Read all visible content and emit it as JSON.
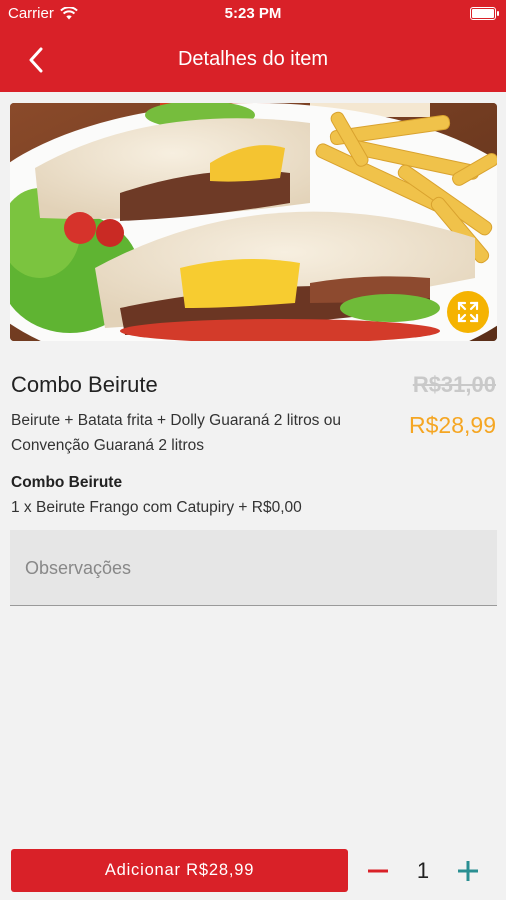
{
  "status_bar": {
    "carrier": "Carrier",
    "time": "5:23 PM"
  },
  "nav": {
    "title": "Detalhes do item"
  },
  "item": {
    "name": "Combo Beirute",
    "old_price": "R$31,00",
    "price": "R$28,99",
    "description": "Beirute + Batata frita + Dolly Guaraná 2 litros ou Convenção Guaraná 2 litros",
    "group_title": "Combo Beirute",
    "group_line": "1 x Beirute Frango com Catupiry + R$0,00"
  },
  "notes": {
    "placeholder": "Observações",
    "value": ""
  },
  "footer": {
    "add_label": "Adicionar R$28,99",
    "quantity": "1"
  },
  "colors": {
    "brand_red": "#d92128",
    "price_orange": "#f5a623",
    "expand_yellow": "#f5b301",
    "plus_teal": "#2a8f92"
  },
  "icons": {
    "back": "chevron-left-icon",
    "wifi": "wifi-icon",
    "battery": "battery-icon",
    "expand": "expand-icon",
    "minus": "minus-icon",
    "plus": "plus-icon"
  }
}
